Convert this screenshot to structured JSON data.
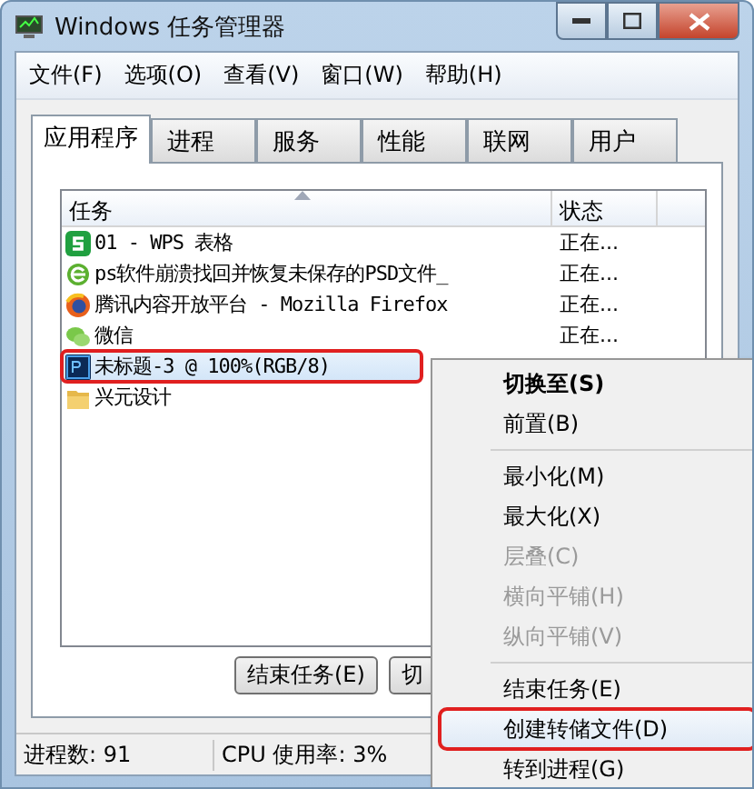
{
  "window": {
    "title": "Windows 任务管理器"
  },
  "menu_bar": [
    "文件(F)",
    "选项(O)",
    "查看(V)",
    "窗口(W)",
    "帮助(H)"
  ],
  "tabs": [
    {
      "label": "应用程序",
      "selected": true
    },
    {
      "label": "进程",
      "selected": false
    },
    {
      "label": "服务",
      "selected": false
    },
    {
      "label": "性能",
      "selected": false
    },
    {
      "label": "联网",
      "selected": false
    },
    {
      "label": "用户",
      "selected": false
    }
  ],
  "table": {
    "columns": [
      "任务",
      "状态"
    ],
    "rows": [
      {
        "kind": "wps",
        "task": "01 - WPS 表格",
        "status": "正在...",
        "selected": false,
        "highlighted": false
      },
      {
        "kind": "ie",
        "task": "ps软件崩溃找回并恢复未保存的PSD文件_",
        "status": "正在...",
        "selected": false,
        "highlighted": false
      },
      {
        "kind": "firefox",
        "task": "腾讯内容开放平台 - Mozilla Firefox",
        "status": "正在...",
        "selected": false,
        "highlighted": false
      },
      {
        "kind": "wechat",
        "task": "微信",
        "status": "正在...",
        "selected": false,
        "highlighted": false
      },
      {
        "kind": "photoshop",
        "task": "未标题-3 @ 100%(RGB/8)",
        "selected": true,
        "highlighted": true
      },
      {
        "kind": "folder",
        "task": "兴元设计",
        "selected": false,
        "highlighted": false
      }
    ]
  },
  "buttons": [
    "结束任务(E)",
    "切"
  ],
  "status_bar": [
    "进程数: 91",
    "CPU 使用率: 3%"
  ],
  "context_menu": [
    {
      "label": "切换至(S)",
      "bold": true,
      "disabled": false,
      "highlighted": false
    },
    {
      "label": "前置(B)",
      "bold": false,
      "disabled": false,
      "highlighted": false,
      "divider_after": true
    },
    {
      "label": "最小化(M)",
      "bold": false,
      "disabled": false,
      "highlighted": false
    },
    {
      "label": "最大化(X)",
      "bold": false,
      "disabled": false,
      "highlighted": false
    },
    {
      "label": "层叠(C)",
      "bold": false,
      "disabled": true,
      "highlighted": false
    },
    {
      "label": "横向平铺(H)",
      "bold": false,
      "disabled": true,
      "highlighted": false
    },
    {
      "label": "纵向平铺(V)",
      "bold": false,
      "disabled": true,
      "highlighted": false,
      "divider_after": true
    },
    {
      "label": "结束任务(E)",
      "bold": false,
      "disabled": false,
      "highlighted": false
    },
    {
      "label": "创建转储文件(D)",
      "bold": false,
      "disabled": false,
      "highlighted": true
    },
    {
      "label": "转到进程(G)",
      "bold": false,
      "disabled": false,
      "highlighted": false
    }
  ]
}
